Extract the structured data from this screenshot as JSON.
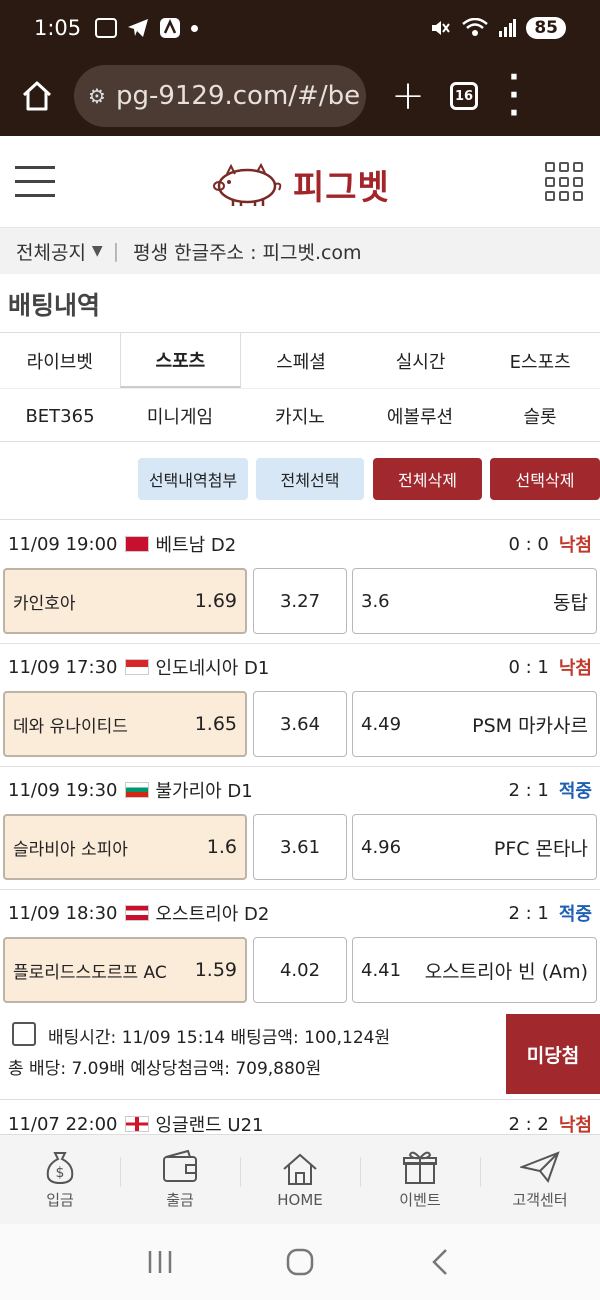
{
  "status_bar": {
    "time": "1:05",
    "battery": "85"
  },
  "browser": {
    "url": "pg-9129.com/#/be",
    "tab_count": "16"
  },
  "header": {
    "logo_text": "피그벳"
  },
  "notice": {
    "category": "전체공지",
    "text": "평생 한글주소 : 피그벳.com"
  },
  "page_title": "배팅내역",
  "tabs_row1": [
    "라이브벳",
    "스포츠",
    "스페셜",
    "실시간",
    "E스포츠"
  ],
  "tabs_row2": [
    "BET365",
    "미니게임",
    "카지노",
    "에볼루션",
    "슬롯"
  ],
  "active_tab": "스포츠",
  "actions": {
    "attach_selected": "선택내역첨부",
    "select_all": "전체선택",
    "delete_all": "전체삭제",
    "delete_selected": "선택삭제"
  },
  "matches": [
    {
      "datetime": "11/09 19:00",
      "league": "베트남 D2",
      "score": "0 : 0",
      "result": "낙첨",
      "home": "카인호아",
      "home_odds": "1.69",
      "draw_odds": "3.27",
      "away_odds": "3.6",
      "away": "동탑"
    },
    {
      "datetime": "11/09 17:30",
      "league": "인도네시아 D1",
      "score": "0 : 1",
      "result": "낙첨",
      "home": "데와 유나이티드",
      "home_odds": "1.65",
      "draw_odds": "3.64",
      "away_odds": "4.49",
      "away": "PSM 마카사르"
    },
    {
      "datetime": "11/09 19:30",
      "league": "불가리아 D1",
      "score": "2 : 1",
      "result": "적중",
      "home": "슬라비아 소피아",
      "home_odds": "1.6",
      "draw_odds": "3.61",
      "away_odds": "4.96",
      "away": "PFC 몬타나"
    },
    {
      "datetime": "11/09 18:30",
      "league": "오스트리아 D2",
      "score": "2 : 1",
      "result": "적중",
      "home": "플로리드스도르프 AC",
      "home_odds": "1.59",
      "draw_odds": "4.02",
      "away_odds": "4.41",
      "away": "오스트리아 빈 (Am)"
    }
  ],
  "summary": {
    "line1": "배팅시간: 11/09 15:14  배팅금액: 100,124원",
    "line2": "총 배당: 7.09배  예상당첨금액: 709,880원",
    "status": "미당첨"
  },
  "next_match": {
    "datetime": "11/07 22:00",
    "league": "잉글랜드 U21",
    "score": "2 : 2",
    "result": "낙첨"
  },
  "bottom_nav": [
    "입금",
    "출금",
    "HOME",
    "이벤트",
    "고객센터"
  ],
  "colors": {
    "accent": "#a1282d",
    "win": "#1e5fb4",
    "lose": "#c0392b",
    "selected_bg": "#fbebd9"
  }
}
